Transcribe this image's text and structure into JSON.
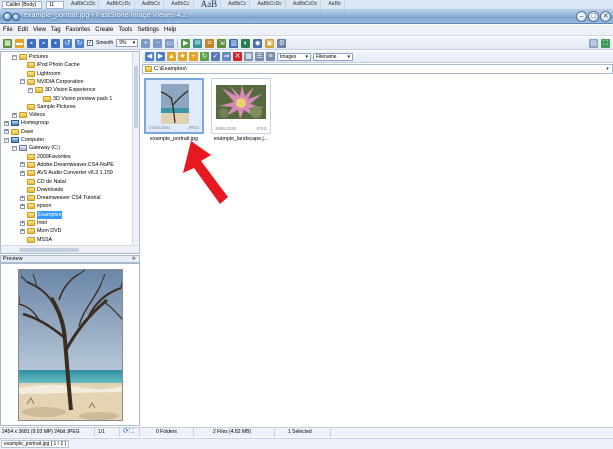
{
  "word_ribbon": {
    "font_name": "Calibri (Body)",
    "font_size": "11",
    "styles": [
      "AaBbCcDc",
      "AaBbCcDc",
      "AaBbCc",
      "AaBbCc",
      "AaB",
      "AaBbCc",
      "AaBbCcDc",
      "AaBbCcDc",
      "AaBb"
    ]
  },
  "window": {
    "title": "example_portrait.jpg - FastStone Image Viewer 4.2",
    "minimize": "–",
    "maximize": "□",
    "close": "✕"
  },
  "menu": [
    "File",
    "Edit",
    "View",
    "Tag",
    "Favorites",
    "Create",
    "Tools",
    "Settings",
    "Help"
  ],
  "toolbar": {
    "smooth_label": "Smooth",
    "zoom_value": "9%",
    "images_filter": "Images",
    "sort_by": "Filename"
  },
  "address": {
    "path": "C:\\Examples\\"
  },
  "tree": {
    "items": [
      {
        "label": "Pictures",
        "depth": 1,
        "expander": "−",
        "kind": "folder"
      },
      {
        "label": "iPod Photo Cache",
        "depth": 2,
        "expander": "",
        "kind": "folder"
      },
      {
        "label": "Lightroom",
        "depth": 2,
        "expander": "",
        "kind": "folder"
      },
      {
        "label": "NVIDIA Corporation",
        "depth": 2,
        "expander": "−",
        "kind": "folder"
      },
      {
        "label": "3D Vision Experience",
        "depth": 3,
        "expander": "−",
        "kind": "folder"
      },
      {
        "label": "3D Vision preview pack 1",
        "depth": 4,
        "expander": "",
        "kind": "folder"
      },
      {
        "label": "Sample Pictures",
        "depth": 2,
        "expander": "",
        "kind": "folder"
      },
      {
        "label": "Videos",
        "depth": 1,
        "expander": "+",
        "kind": "folder"
      },
      {
        "label": "Homegroup",
        "depth": 0,
        "expander": "+",
        "kind": "pc"
      },
      {
        "label": "Dave",
        "depth": 0,
        "expander": "+",
        "kind": "folder"
      },
      {
        "label": "Computer",
        "depth": 0,
        "expander": "−",
        "kind": "pc"
      },
      {
        "label": "Gateway (C:)",
        "depth": 1,
        "expander": "−",
        "kind": "drive"
      },
      {
        "label": "2009Favorites",
        "depth": 2,
        "expander": "",
        "kind": "folder"
      },
      {
        "label": "Adobe.Dreamweaver.CS4-NoPE",
        "depth": 2,
        "expander": "+",
        "kind": "folder"
      },
      {
        "label": "AVS Audio Converter v6.2.1.159",
        "depth": 2,
        "expander": "+",
        "kind": "folder"
      },
      {
        "label": "CD de Natal",
        "depth": 2,
        "expander": "",
        "kind": "folder"
      },
      {
        "label": "Downloads",
        "depth": 2,
        "expander": "",
        "kind": "folder"
      },
      {
        "label": "Dreamweaver CS4 Tutorial",
        "depth": 2,
        "expander": "+",
        "kind": "folder"
      },
      {
        "label": "epson",
        "depth": 2,
        "expander": "+",
        "kind": "folder"
      },
      {
        "label": "Examples",
        "depth": 2,
        "expander": "",
        "kind": "folder",
        "selected": true
      },
      {
        "label": "Intel",
        "depth": 2,
        "expander": "+",
        "kind": "folder"
      },
      {
        "label": "Mom DVD",
        "depth": 2,
        "expander": "+",
        "kind": "folder"
      },
      {
        "label": "MSSA",
        "depth": 2,
        "expander": "",
        "kind": "folder"
      }
    ]
  },
  "preview": {
    "title": "Preview",
    "pin": "∓"
  },
  "thumbnails": [
    {
      "name": "example_portrait.jpg",
      "dims": "2454x3681",
      "type": "JPEG",
      "selected": true
    },
    {
      "name": "example_landscape.j...",
      "dims": "3888x2592",
      "type": "JPEG",
      "selected": false
    }
  ],
  "status": {
    "image_info": "2454 x 3681 (9.03 MP)  24bit JPEG",
    "page": "1/1",
    "folders": "0 Folders",
    "files": "2 Files (4.82 MB)",
    "selected": "1 Selected"
  },
  "filebar": {
    "current": "example_portrait.jpg [ 1 / 2 ]"
  },
  "colors": {
    "selection": "#3399ff",
    "thumb_selected_border": "#7aa7de",
    "arrow": "#e8191e"
  }
}
